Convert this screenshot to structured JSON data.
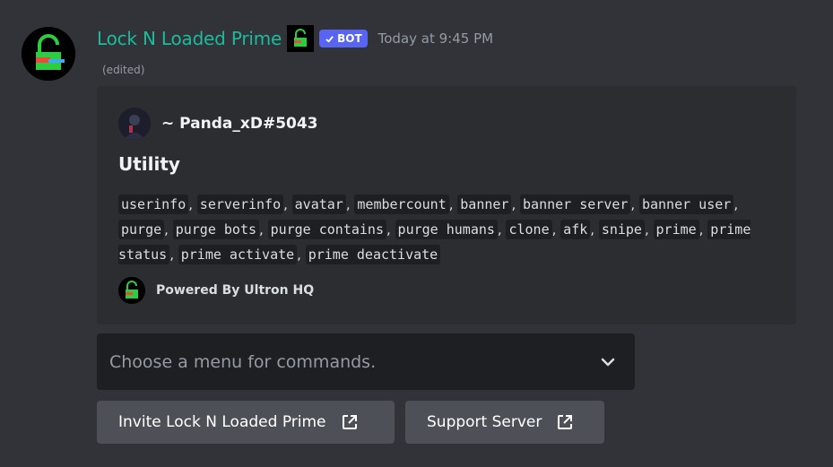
{
  "message": {
    "username": "Lock N Loaded Prime",
    "bot_badge": "BOT",
    "timestamp": "Today at 9:45 PM",
    "edited_label": "(edited)",
    "username_color": "#1abc9c",
    "badge_color": "#5865f2"
  },
  "embed": {
    "author": "~ Panda_xD#5043",
    "title": "Utility",
    "commands": [
      "userinfo",
      "serverinfo",
      "avatar",
      "membercount",
      "banner",
      "banner server",
      "banner user",
      "purge",
      "purge bots",
      "purge contains",
      "purge humans",
      "clone",
      "afk",
      "snipe",
      "prime",
      "prime status",
      "prime activate",
      "prime deactivate"
    ],
    "footer": "Powered By Ultron HQ"
  },
  "select_menu": {
    "placeholder": "Choose a menu for commands.",
    "icon": "chevron-down-icon"
  },
  "buttons": [
    {
      "label": "Invite Lock N Loaded Prime",
      "icon": "external-link-icon"
    },
    {
      "label": "Support Server",
      "icon": "external-link-icon"
    }
  ]
}
